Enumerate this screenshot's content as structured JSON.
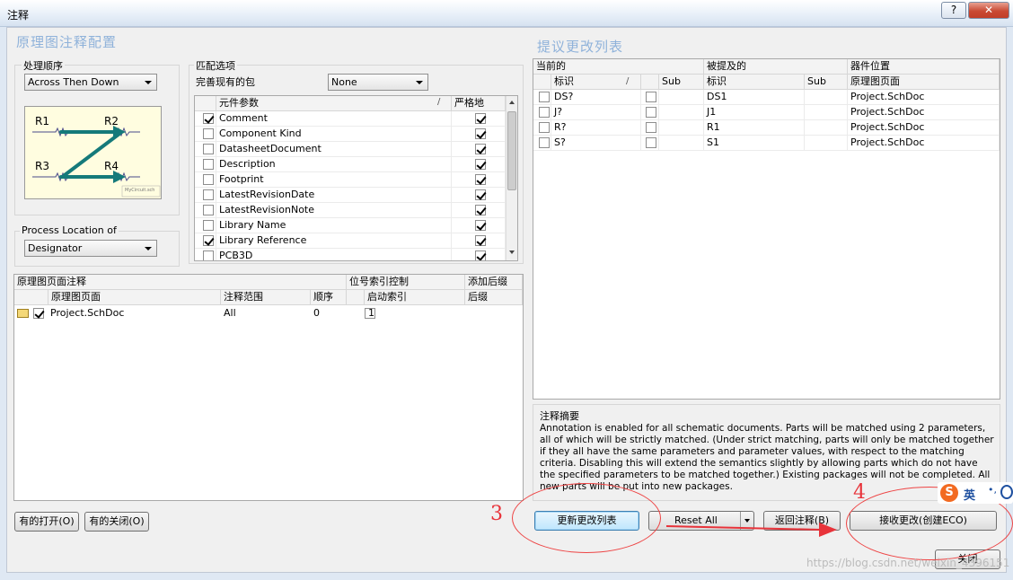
{
  "window": {
    "title": "注释",
    "help_label": "?",
    "close_glyph": "✕"
  },
  "left": {
    "section_title": "原理图注释配置",
    "order_group": {
      "label": "处理顺序",
      "combo_value": "Across Then Down"
    },
    "diagram": {
      "labels": [
        "R1",
        "R2",
        "R3",
        "R4"
      ],
      "caption": "MyCircuit.sch"
    },
    "location_group": {
      "label": "Process Location of",
      "combo_value": "Designator"
    },
    "match_group": {
      "label": "匹配选项",
      "complete_label": "完善现有的包",
      "complete_value": "None",
      "col_param": "元件参数",
      "col_sort": "/",
      "col_strict": "严格地",
      "rows": [
        {
          "name": "Comment",
          "checked": true,
          "strict": true
        },
        {
          "name": "Component Kind",
          "checked": false,
          "strict": true
        },
        {
          "name": "DatasheetDocument",
          "checked": false,
          "strict": true
        },
        {
          "name": "Description",
          "checked": false,
          "strict": true
        },
        {
          "name": "Footprint",
          "checked": false,
          "strict": true
        },
        {
          "name": "LatestRevisionDate",
          "checked": false,
          "strict": true
        },
        {
          "name": "LatestRevisionNote",
          "checked": false,
          "strict": true
        },
        {
          "name": "Library Name",
          "checked": false,
          "strict": true
        },
        {
          "name": "Library Reference",
          "checked": true,
          "strict": true
        },
        {
          "name": "PCB3D",
          "checked": false,
          "strict": true
        }
      ]
    },
    "sheets": {
      "group1": "原理图页面注释",
      "group2": "位号索引控制",
      "group3": "添加后缀",
      "col_sheet": "原理图页面",
      "col_scope": "注释范围",
      "col_order": "顺序",
      "col_start": "启动索引",
      "col_suffix": "后缀",
      "rows": [
        {
          "sheet": "Project.SchDoc",
          "checked": true,
          "scope": "All",
          "order": "0",
          "start_checked": false,
          "start": "1",
          "suffix": ""
        }
      ]
    },
    "btn_all_on": "有的打开(O)",
    "btn_all_off": "有的关闭(O)"
  },
  "right": {
    "section_title": "提议更改列表",
    "grp_current": "当前的",
    "grp_proposed": "被提及的",
    "grp_location": "器件位置",
    "col_id": "标识",
    "col_sort": "/",
    "col_sub": "Sub",
    "col_sheet": "原理图页面",
    "rows": [
      {
        "current": "DS?",
        "proposed": "DS1",
        "sheet": "Project.SchDoc"
      },
      {
        "current": "J?",
        "proposed": "J1",
        "sheet": "Project.SchDoc"
      },
      {
        "current": "R?",
        "proposed": "R1",
        "sheet": "Project.SchDoc"
      },
      {
        "current": "S?",
        "proposed": "S1",
        "sheet": "Project.SchDoc"
      }
    ],
    "summary_label": "注释摘要",
    "summary_text": "Annotation is enabled for all schematic documents. Parts will be matched using 2 parameters, all of which will be strictly matched. (Under strict matching, parts will only be matched together if they all have the same parameters and parameter values, with respect to the matching criteria. Disabling this will extend the semantics slightly by allowing parts which do not have the specified parameters to be matched together.) Existing packages will not be completed. All new parts will be put into new packages."
  },
  "buttons": {
    "update": "更新更改列表",
    "reset": "Reset All",
    "back": "返回注释(B)",
    "accept": "接收更改(创建ECO)",
    "close": "关闭"
  },
  "annotations": {
    "num3": "3",
    "num4": "4",
    "ime_label": "英",
    "watermark": "https://blog.csdn.net/weixin_4396151"
  },
  "colors": {
    "title_blue": "#8fb2da",
    "arrow_teal": "#157a7a",
    "diagram_bg": "#fffde0",
    "annot_red": "#e8333a",
    "ime_orange": "#f26a21"
  }
}
